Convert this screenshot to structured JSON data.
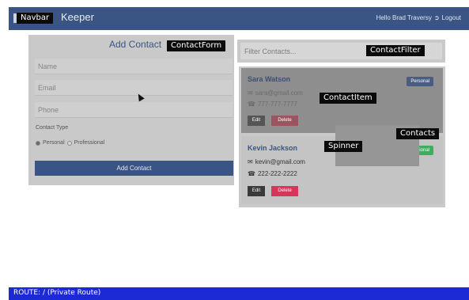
{
  "navbar": {
    "tag": "Navbar",
    "brand": "Keeper",
    "greeting": "Hello Brad Traversy",
    "logout": "Logout"
  },
  "contact_form": {
    "tag": "ContactForm",
    "title": "Add Contact",
    "name_placeholder": "Name",
    "email_placeholder": "Email",
    "phone_placeholder": "Phone",
    "contact_type_label": "Contact Type",
    "option_personal": "Personal",
    "option_professional": "Professional",
    "selected_type": "Personal",
    "submit_label": "Add Contact"
  },
  "contact_filter": {
    "tag": "ContactFilter",
    "placeholder": "Filter Contacts..."
  },
  "contacts": {
    "tag": "Contacts",
    "item_tag": "ContactItem",
    "spinner_tag": "Spinner",
    "items": [
      {
        "name": "Sara Watson",
        "email": "sara@gmail.com",
        "phone": "777-777-7777",
        "type": "Personal",
        "type_color": "#3a5484",
        "edit_label": "Edit",
        "delete_label": "Delete"
      },
      {
        "name": "Kevin Jackson",
        "email": "kevin@gmail.com",
        "phone": "222-222-2222",
        "type": "Professional",
        "type_color": "#3cae5e",
        "edit_label": "Edit",
        "delete_label": "Delete"
      }
    ]
  },
  "footer": {
    "route_text": "ROUTE: / (Private Route)",
    "background": "#1c2ad6"
  }
}
